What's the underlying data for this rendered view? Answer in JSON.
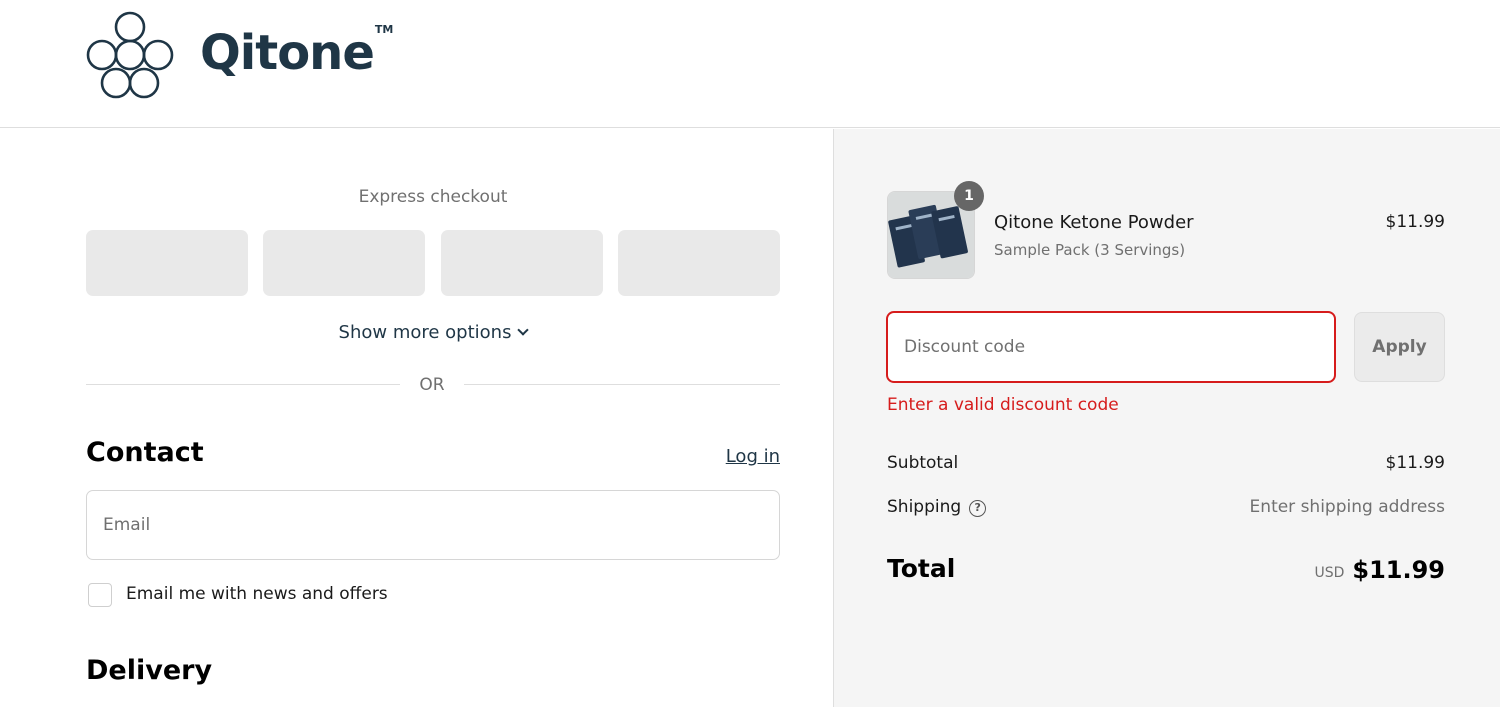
{
  "brand": {
    "name": "Qitone",
    "trademark": "TM",
    "color": "#1f3646"
  },
  "express_checkout": {
    "title": "Express checkout",
    "button_count": 4,
    "show_more": "Show more options",
    "divider": "OR"
  },
  "contact": {
    "title": "Contact",
    "login_link": "Log in",
    "email_placeholder": "Email",
    "newsletter_label": "Email me with news and offers"
  },
  "delivery": {
    "title": "Delivery"
  },
  "order_summary": {
    "item": {
      "name": "Qitone Ketone Powder",
      "variant": "Sample Pack (3 Servings)",
      "price": "$11.99",
      "quantity": "1"
    },
    "discount": {
      "placeholder": "Discount code",
      "apply_label": "Apply",
      "error": "Enter a valid discount code",
      "error_color": "#d61c1c"
    },
    "subtotal": {
      "label": "Subtotal",
      "value": "$11.99"
    },
    "shipping": {
      "label": "Shipping",
      "value": "Enter shipping address"
    },
    "total": {
      "label": "Total",
      "currency": "USD",
      "value": "$11.99"
    }
  }
}
